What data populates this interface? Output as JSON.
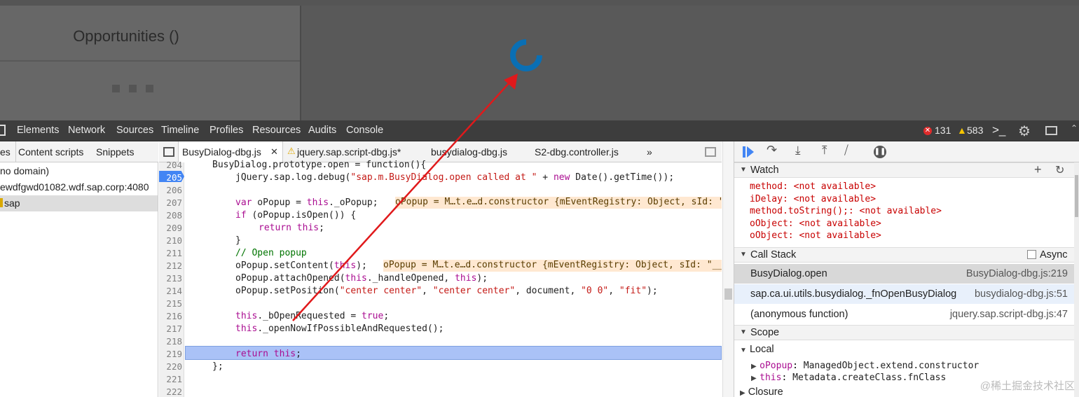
{
  "app": {
    "title": "Opportunities ()"
  },
  "devtools_tabs": [
    "Elements",
    "Network",
    "Sources",
    "Timeline",
    "Profiles",
    "Resources",
    "Audits",
    "Console"
  ],
  "counters": {
    "errors": "131",
    "warnings": "583"
  },
  "navigator": {
    "tabs": [
      "es",
      "Content scripts",
      "Snippets"
    ],
    "tree": [
      "no domain)",
      "ewdfgwd01082.wdf.sap.corp:4080",
      "sap"
    ]
  },
  "editor": {
    "tabs": [
      "BusyDialog-dbg.js",
      "jquery.sap.script-dbg.js*",
      "busydialog-dbg.js",
      "S2-dbg.controller.js"
    ],
    "more": "»",
    "line_numbers": [
      "204",
      "205",
      "206",
      "207",
      "208",
      "209",
      "210",
      "211",
      "212",
      "213",
      "214",
      "215",
      "216",
      "217",
      "218",
      "219",
      "220",
      "221",
      "222"
    ],
    "code": {
      "l204": "BusyDialog.prototype.open = function(){",
      "l205_a": "jQuery.sap.log.debug(",
      "l205_s": "\"sap.m.BusyDialog.open called at \"",
      "l205_b": " + ",
      "l205_k": "new",
      "l205_c": " Date().getTime());",
      "l207_k": "var",
      "l207_a": " oPopup = ",
      "l207_k2": "this",
      "l207_b": "._oPopup;",
      "l207_inline": "oPopup = M…t.e…d.constructor {mEventRegistry: Object, sId: \"__popup",
      "l208_k": "if",
      "l208_a": " (oPopup.isOpen()) {",
      "l209_k": "return",
      "l209_k2": "this",
      "l209_a": ";",
      "l210": "}",
      "l211": "// Open popup",
      "l212_a": "oPopup.setContent(",
      "l212_k": "this",
      "l212_b": ");",
      "l212_inline": "oPopup = M…t.e…d.constructor {mEventRegistry: Object, sId: \"__po",
      "l213_a": "oPopup.attachOpened(",
      "l213_k": "this",
      "l213_b": "._handleOpened, ",
      "l213_k2": "this",
      "l213_c": ");",
      "l214_a": "oPopup.setPosition(",
      "l214_s1": "\"center center\"",
      "l214_b": ", ",
      "l214_s2": "\"center center\"",
      "l214_c": ", document, ",
      "l214_s3": "\"0 0\"",
      "l214_d": ", ",
      "l214_s4": "\"fit\"",
      "l214_e": ");",
      "l216_k": "this",
      "l216_a": "._bOpenRequested = ",
      "l216_k2": "true",
      "l216_b": ";",
      "l217_k": "this",
      "l217_a": "._openNowIfPossibleAndRequested();",
      "l219_k": "return",
      "l219_k2": "this",
      "l219_a": ";",
      "l220": "};"
    }
  },
  "watch": {
    "label": "Watch",
    "items": [
      {
        "name": "method",
        "value": "<not available>"
      },
      {
        "name": "iDelay",
        "value": "<not available>"
      },
      {
        "name": "method.toString();",
        "value": "<not available>"
      },
      {
        "name": "oObject",
        "value": "<not available>"
      },
      {
        "name": "oObject",
        "value": "<not available>"
      }
    ]
  },
  "call_stack": {
    "label": "Call Stack",
    "async_label": "Async",
    "frames": [
      {
        "fn": "BusyDialog.open",
        "loc": "BusyDialog-dbg.js:219"
      },
      {
        "fn": "sap.ca.ui.utils.busydialog._fnOpenBusyDialog",
        "loc": "busydialog-dbg.js:51"
      },
      {
        "fn": "(anonymous function)",
        "loc": "jquery.sap.script-dbg.js:47"
      }
    ]
  },
  "scope": {
    "label": "Scope",
    "local_label": "Local",
    "vars": [
      {
        "name": "oPopup",
        "value": "ManagedObject.extend.constructor"
      },
      {
        "name": "this",
        "value": "Metadata.createClass.fnClass"
      }
    ],
    "closure_label": "Closure"
  },
  "watermark": "@稀土掘金技术社区",
  "colors": {
    "spinner": "#0a6fb4",
    "arrow": "#e0191b",
    "highlight": "#aac2f7",
    "accent": "#4285f4"
  }
}
